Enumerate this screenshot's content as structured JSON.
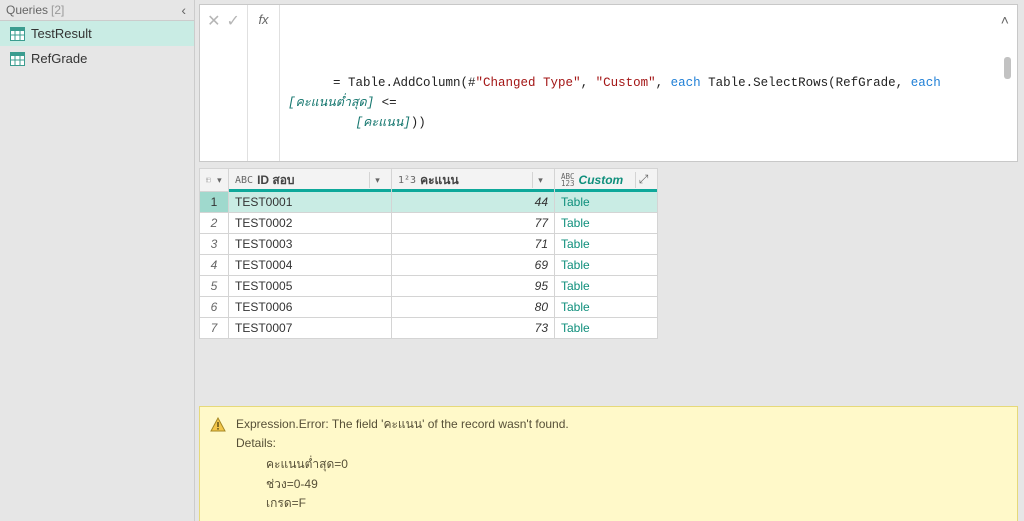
{
  "sidebar": {
    "title": "Queries",
    "count": "[2]",
    "queries": [
      {
        "name": "TestResult",
        "active": true
      },
      {
        "name": "RefGrade",
        "active": false
      }
    ]
  },
  "formula": {
    "prefix": "= Table.AddColumn(#",
    "arg_step": "\"Changed Type\"",
    "sep1": ", ",
    "arg_name": "\"Custom\"",
    "sep2": ", ",
    "kw_each1": "each",
    "mid": " Table.SelectRows(RefGrade, ",
    "kw_each2": "each",
    "space": " ",
    "col1": "[คะแนนต่ำสุด]",
    "op": " <= ",
    "indent": "         ",
    "col2": "[คะแนน]",
    "close": "))"
  },
  "grid": {
    "headers": {
      "id_sob": "ID สอบ",
      "score": "คะแนน",
      "custom": "Custom"
    },
    "type_labels": {
      "text": "ABC",
      "number": "1²3",
      "any_top": "ABC",
      "any_bot": "123"
    },
    "rows": [
      {
        "n": "1",
        "id": "TEST0001",
        "score": "44",
        "custom": "Table",
        "selected": true
      },
      {
        "n": "2",
        "id": "TEST0002",
        "score": "77",
        "custom": "Table",
        "selected": false
      },
      {
        "n": "3",
        "id": "TEST0003",
        "score": "71",
        "custom": "Table",
        "selected": false
      },
      {
        "n": "4",
        "id": "TEST0004",
        "score": "69",
        "custom": "Table",
        "selected": false
      },
      {
        "n": "5",
        "id": "TEST0005",
        "score": "95",
        "custom": "Table",
        "selected": false
      },
      {
        "n": "6",
        "id": "TEST0006",
        "score": "80",
        "custom": "Table",
        "selected": false
      },
      {
        "n": "7",
        "id": "TEST0007",
        "score": "73",
        "custom": "Table",
        "selected": false
      }
    ]
  },
  "error": {
    "title": "Expression.Error: The field 'คะแนน' of the record wasn't found.",
    "details_label": "Details:",
    "lines": [
      "คะแนนต่ำสุด=0",
      "ช่วง=0-49",
      "เกรด=F"
    ]
  },
  "icons": {
    "cancel": "✕",
    "confirm": "✓",
    "fx": "fx",
    "chev_up": "˄",
    "chev_dn": "▾",
    "expand": "⤢",
    "close_panel": "‹"
  }
}
